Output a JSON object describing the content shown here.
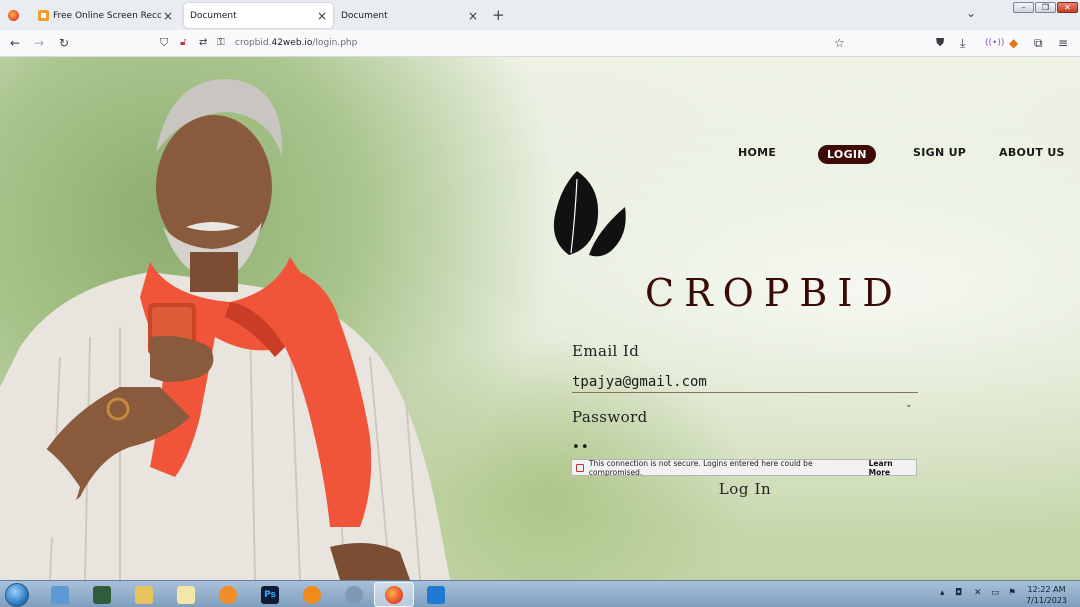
{
  "browser": {
    "tabs": [
      {
        "title": "Free Online Screen Recorder &",
        "active": false
      },
      {
        "title": "Document",
        "active": true
      },
      {
        "title": "Document",
        "active": false
      }
    ],
    "close_glyph": "×",
    "new_tab_glyph": "+",
    "list_tabs_glyph": "⌄",
    "window_controls": {
      "minimize": "–",
      "restore": "❐",
      "close": "✕"
    },
    "url_prefix": "cropbid.",
    "url_host": "42web.io",
    "url_path": "/login.php"
  },
  "site": {
    "nav": {
      "home": "HOME",
      "login": "LOGIN",
      "signup": "SIGN UP",
      "about": "ABOUT US"
    },
    "brand": "CROPBID",
    "accent_color": "#3d0a06"
  },
  "form": {
    "email_label": "Email Id",
    "email_value": "tpajya@gmail.com",
    "password_label": "Password",
    "password_value": "••",
    "insecure_warning": "This connection is not secure. Logins entered here could be compromised.",
    "learn_more": "Learn More",
    "submit": "Log In"
  },
  "taskbar": {
    "time": "12:22 AM",
    "date": "7/11/2023",
    "apps": [
      "explorer-icon",
      "terminal-icon",
      "folder-icon",
      "notepad-icon",
      "media-player-icon",
      "photoshop-icon",
      "fl-studio-icon",
      "snipping-icon",
      "firefox-icon",
      "vscode-icon"
    ],
    "photoshop_glyph": "Ps"
  }
}
